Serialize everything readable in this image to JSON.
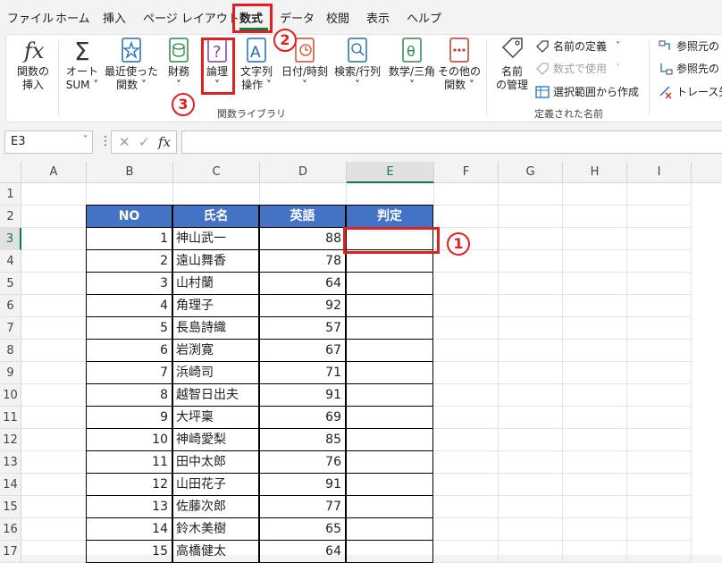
{
  "tabs": [
    "ファイル",
    "ホーム",
    "挿入",
    "ページ レイアウト",
    "数式",
    "データ",
    "校閲",
    "表示",
    "ヘルプ"
  ],
  "ribbon": {
    "insert_function": [
      "関数の",
      "挿入"
    ],
    "autosum": [
      "オート",
      "SUM ˅"
    ],
    "recent": [
      "最近使った",
      "関数 ˅"
    ],
    "financial": [
      "財務",
      "˅"
    ],
    "logical": [
      "論理",
      "˅"
    ],
    "text": [
      "文字列",
      "操作 ˅"
    ],
    "datetime": [
      "日付/時刻",
      "˅"
    ],
    "lookup": [
      "検索/行列",
      "˅"
    ],
    "math": [
      "数学/三角",
      "˅"
    ],
    "more": [
      "その他の",
      "関数 ˅"
    ],
    "library_label": "関数ライブラリ",
    "name_manager": [
      "名前",
      "の管理"
    ],
    "define_name": "名前の定義",
    "define_name_arrow": "˅",
    "use_in_formula": "数式で使用",
    "use_in_formula_arrow": "˅",
    "create_from_selection": "選択範囲から作成",
    "defined_names_label": "定義された名前",
    "trace_precedents": "参照元の",
    "trace_dependents": "参照先の",
    "remove_arrows": "トレース矢"
  },
  "annotations": {
    "one": "1",
    "two": "2",
    "three": "3"
  },
  "formula_bar": {
    "name_box": "E3",
    "dropdown": "˅",
    "dots": "⋮",
    "cancel": "✕",
    "enter": "✓",
    "fx": "fx",
    "value": ""
  },
  "columns": [
    "A",
    "B",
    "C",
    "D",
    "E",
    "F",
    "G",
    "H",
    "I"
  ],
  "rows": [
    "1",
    "2",
    "3",
    "4",
    "5",
    "6",
    "7",
    "8",
    "9",
    "10",
    "11",
    "12",
    "13",
    "14",
    "15",
    "16",
    "17"
  ],
  "table_headers": {
    "no": "NO",
    "name": "氏名",
    "english": "英語",
    "judge": "判定"
  },
  "table_rows": [
    {
      "no": "1",
      "name": "神山武一",
      "english": "88",
      "judge": ""
    },
    {
      "no": "2",
      "name": "遠山舞香",
      "english": "78",
      "judge": ""
    },
    {
      "no": "3",
      "name": "山村蘭",
      "english": "64",
      "judge": ""
    },
    {
      "no": "4",
      "name": "角理子",
      "english": "92",
      "judge": ""
    },
    {
      "no": "5",
      "name": "長島詩織",
      "english": "57",
      "judge": ""
    },
    {
      "no": "6",
      "name": "岩渕寛",
      "english": "67",
      "judge": ""
    },
    {
      "no": "7",
      "name": "浜崎司",
      "english": "71",
      "judge": ""
    },
    {
      "no": "8",
      "name": "越智日出夫",
      "english": "91",
      "judge": ""
    },
    {
      "no": "9",
      "name": "大坪稟",
      "english": "69",
      "judge": ""
    },
    {
      "no": "10",
      "name": "神崎愛梨",
      "english": "85",
      "judge": ""
    },
    {
      "no": "11",
      "name": "田中太郎",
      "english": "76",
      "judge": ""
    },
    {
      "no": "12",
      "name": "山田花子",
      "english": "91",
      "judge": ""
    },
    {
      "no": "13",
      "name": "佐藤次郎",
      "english": "77",
      "judge": ""
    },
    {
      "no": "14",
      "name": "鈴木美樹",
      "english": "65",
      "judge": ""
    },
    {
      "no": "15",
      "name": "高橋健太",
      "english": "64",
      "judge": ""
    }
  ],
  "colors": {
    "accent": "#107c41",
    "annotation": "#e02020",
    "table_header": "#4472c4"
  }
}
